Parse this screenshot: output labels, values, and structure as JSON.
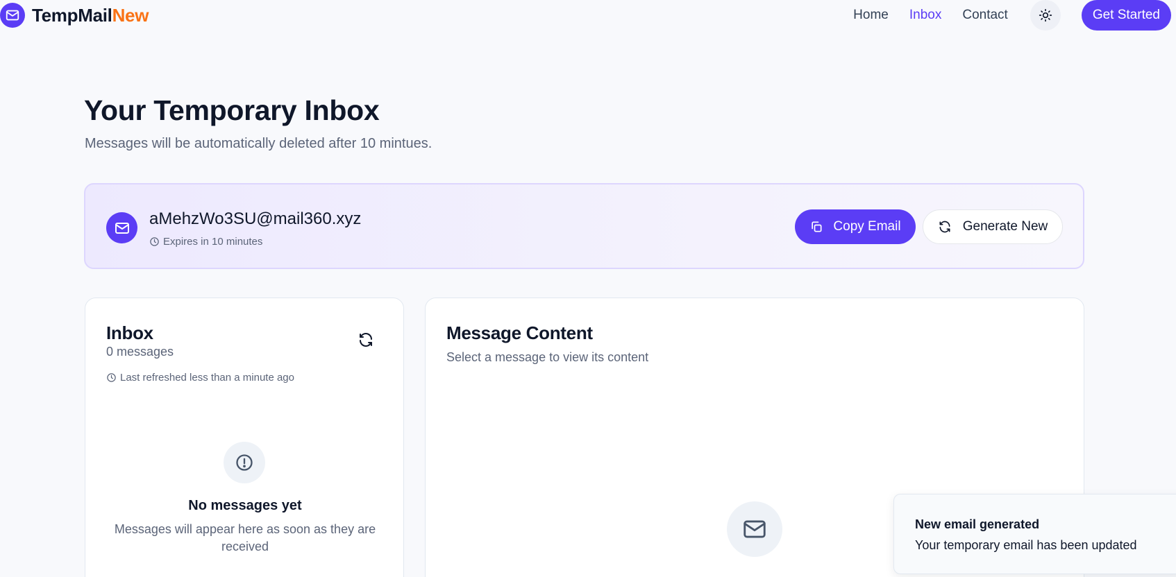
{
  "brand": {
    "name_part1": "TempMail",
    "name_part2": "New"
  },
  "nav": {
    "items": [
      {
        "label": "Home"
      },
      {
        "label": "Inbox"
      },
      {
        "label": "Contact"
      }
    ],
    "cta_label": "Get Started"
  },
  "page": {
    "title": "Your Temporary Inbox",
    "subtitle": "Messages will be automatically deleted after 10 mintues."
  },
  "email_card": {
    "address": "aMehzWo3SU@mail360.xyz",
    "expires": "Expires in 10 minutes",
    "copy_label": "Copy Email",
    "generate_label": "Generate New"
  },
  "inbox": {
    "title": "Inbox",
    "count": "0 messages",
    "last_refreshed": "Last refreshed less than a minute ago",
    "empty_title": "No messages yet",
    "empty_desc": "Messages will appear here as soon as they are received"
  },
  "content": {
    "title": "Message Content",
    "subtitle": "Select a message to view its content"
  },
  "toast": {
    "title": "New email generated",
    "desc": "Your temporary email has been updated"
  },
  "colors": {
    "accent": "#5b3df5",
    "brand_secondary": "#f97316",
    "muted_text": "#5b6478"
  },
  "icons": {
    "brand": "mail-icon",
    "theme": "sun-icon",
    "copy": "copy-icon",
    "generate": "refresh-icon",
    "clock": "clock-icon",
    "empty_inbox": "alert-circle-icon",
    "empty_content": "mail-icon"
  }
}
